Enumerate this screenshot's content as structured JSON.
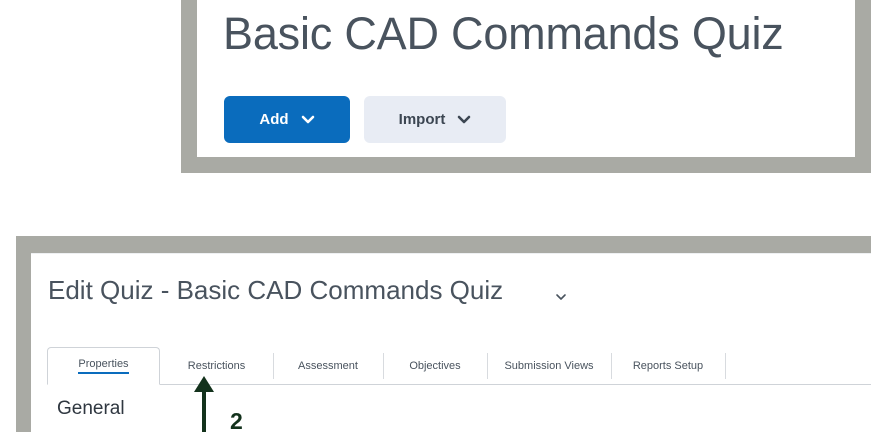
{
  "quiz_header": {
    "title": "Basic CAD Commands Quiz",
    "add_label": "Add",
    "import_label": "Import"
  },
  "edit_page": {
    "title": "Edit Quiz - Basic CAD Commands Quiz",
    "tabs": [
      {
        "label": "Properties",
        "active": true
      },
      {
        "label": "Restrictions"
      },
      {
        "label": "Assessment"
      },
      {
        "label": "Objectives"
      },
      {
        "label": "Submission Views"
      },
      {
        "label": "Reports Setup"
      }
    ],
    "section_heading": "General"
  },
  "annotation": {
    "step_number": "2",
    "arrow_target": "Restrictions tab",
    "arrow_color": "#13321c"
  },
  "colors": {
    "primary_button": "#0a6cbd",
    "secondary_button": "#e8ecf4",
    "frame": "#a9aaa4"
  }
}
